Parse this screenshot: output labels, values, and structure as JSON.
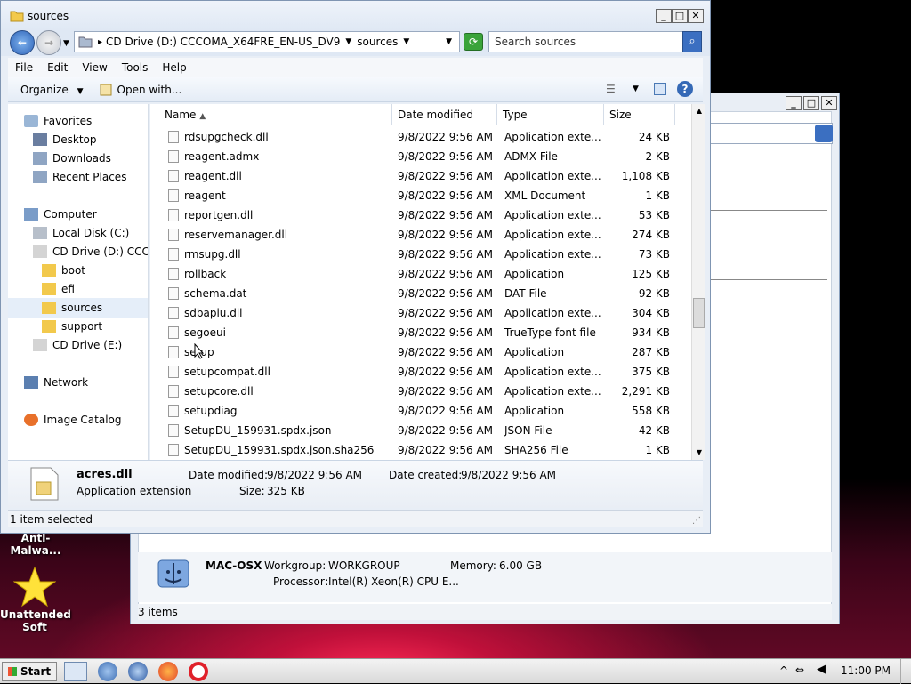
{
  "desktop": {
    "icon1_label": "Anti-Malwa...",
    "icon2_label_line1": "Unattended",
    "icon2_label_line2": "Soft"
  },
  "bg_window": {
    "computer_name": "MAC-OSX",
    "workgroup_label": "Workgroup:",
    "workgroup_value": "WORKGROUP",
    "memory_label": "Memory:",
    "memory_value": "6.00 GB",
    "processor_label": "Processor:",
    "processor_value": "Intel(R) Xeon(R) CPU E...",
    "status": "3 items"
  },
  "window": {
    "title": "sources",
    "address": {
      "drive": "CD Drive (D:) CCCOMA_X64FRE_EN-US_DV9",
      "folder": "sources"
    },
    "search_placeholder": "Search sources",
    "menu": [
      "File",
      "Edit",
      "View",
      "Tools",
      "Help"
    ],
    "organize_label": "Organize",
    "open_with_label": "Open with...",
    "nav": {
      "favorites": "Favorites",
      "desktop": "Desktop",
      "downloads": "Downloads",
      "recent": "Recent Places",
      "computer": "Computer",
      "local_disk": "Local Disk (C:)",
      "cd_d": "CD Drive (D:) CCCOMA",
      "boot": "boot",
      "efi": "efi",
      "sources": "sources",
      "support": "support",
      "cd_e": "CD Drive (E:)",
      "network": "Network",
      "image_catalog": "Image Catalog"
    },
    "columns": {
      "name": "Name",
      "date": "Date modified",
      "type": "Type",
      "size": "Size"
    },
    "files": [
      {
        "name": "rdsupgcheck.dll",
        "date": "9/8/2022 9:56 AM",
        "type": "Application exte...",
        "size": "24 KB"
      },
      {
        "name": "reagent.admx",
        "date": "9/8/2022 9:56 AM",
        "type": "ADMX File",
        "size": "2 KB"
      },
      {
        "name": "reagent.dll",
        "date": "9/8/2022 9:56 AM",
        "type": "Application exte...",
        "size": "1,108 KB"
      },
      {
        "name": "reagent",
        "date": "9/8/2022 9:56 AM",
        "type": "XML Document",
        "size": "1 KB"
      },
      {
        "name": "reportgen.dll",
        "date": "9/8/2022 9:56 AM",
        "type": "Application exte...",
        "size": "53 KB"
      },
      {
        "name": "reservemanager.dll",
        "date": "9/8/2022 9:56 AM",
        "type": "Application exte...",
        "size": "274 KB"
      },
      {
        "name": "rmsupg.dll",
        "date": "9/8/2022 9:56 AM",
        "type": "Application exte...",
        "size": "73 KB"
      },
      {
        "name": "rollback",
        "date": "9/8/2022 9:56 AM",
        "type": "Application",
        "size": "125 KB"
      },
      {
        "name": "schema.dat",
        "date": "9/8/2022 9:56 AM",
        "type": "DAT File",
        "size": "92 KB"
      },
      {
        "name": "sdbapiu.dll",
        "date": "9/8/2022 9:56 AM",
        "type": "Application exte...",
        "size": "304 KB"
      },
      {
        "name": "segoeui",
        "date": "9/8/2022 9:56 AM",
        "type": "TrueType font file",
        "size": "934 KB"
      },
      {
        "name": "setup",
        "date": "9/8/2022 9:56 AM",
        "type": "Application",
        "size": "287 KB"
      },
      {
        "name": "setupcompat.dll",
        "date": "9/8/2022 9:56 AM",
        "type": "Application exte...",
        "size": "375 KB"
      },
      {
        "name": "setupcore.dll",
        "date": "9/8/2022 9:56 AM",
        "type": "Application exte...",
        "size": "2,291 KB"
      },
      {
        "name": "setupdiag",
        "date": "9/8/2022 9:56 AM",
        "type": "Application",
        "size": "558 KB"
      },
      {
        "name": "SetupDU_159931.spdx.json",
        "date": "9/8/2022 9:56 AM",
        "type": "JSON File",
        "size": "42 KB"
      },
      {
        "name": "SetupDU_159931.spdx.json.sha256",
        "date": "9/8/2022 9:56 AM",
        "type": "SHA256 File",
        "size": "1 KB"
      }
    ],
    "details": {
      "file_name": "acres.dll",
      "file_type": "Application extension",
      "modified_label": "Date modified:",
      "modified_value": "9/8/2022 9:56 AM",
      "created_label": "Date created:",
      "created_value": "9/8/2022 9:56 AM",
      "size_label": "Size:",
      "size_value": "325 KB"
    },
    "status": "1 item selected"
  },
  "taskbar": {
    "start": "Start",
    "time": "11:00 PM"
  }
}
